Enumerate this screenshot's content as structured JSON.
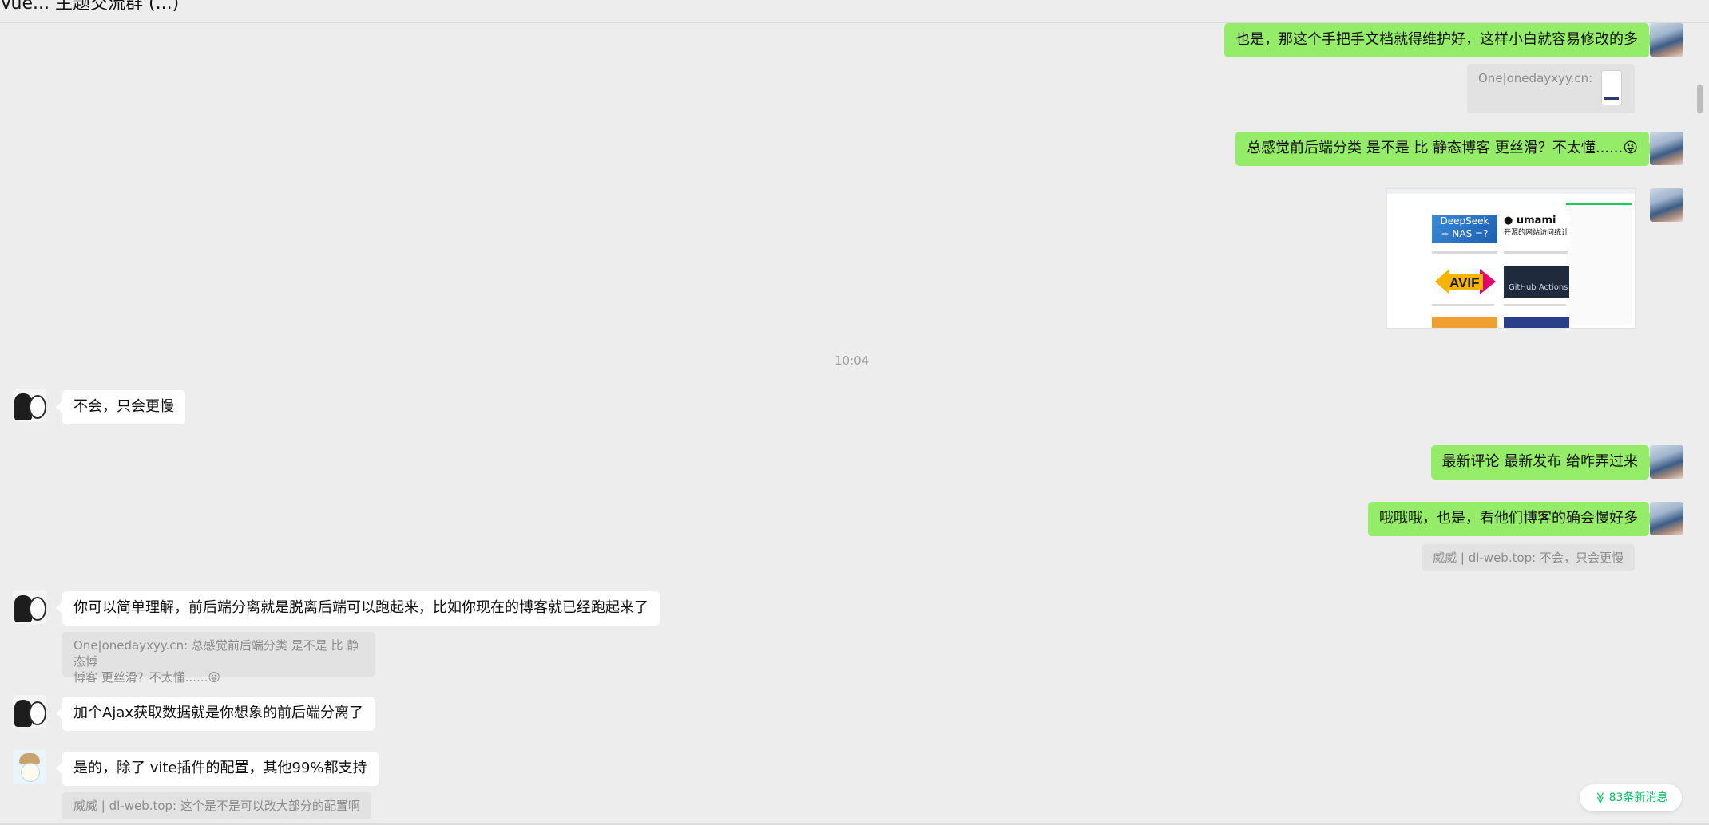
{
  "header": {
    "title": "Vue... 主题交流群 (...)",
    "more_icon": "⋯"
  },
  "messages": {
    "m1": "也是，那这个手把手文档就得维护好，这样小白就容易修改的多",
    "q1": "One|onedayxyy.cn:",
    "m2": "总感觉前后端分类 是不是 比 静态博客 更丝滑？不太懂......",
    "m2_emoji": "😜",
    "time": "10:04",
    "m3": "不会，只会更慢",
    "m4": "最新评论 最新发布 给咋弄过来",
    "m5": "哦哦哦，也是，看他们博客的确会慢好多",
    "q5": "威威 | dl-web.top: 不会，只会更慢",
    "m6": "你可以简单理解，前后端分离就是脱离后端可以跑起来，比如你现在的博客就已经跑起来了",
    "q6_line1": "One|onedayxyy.cn: 总感觉前后端分类 是不是 比 静态博",
    "q6_line2": "博客 更丝滑？不太懂......",
    "m7": "加个Ajax获取数据就是你想象的前后端分离了",
    "m8": "是的，除了 vite插件的配置，其他99%都支持",
    "q8": "威威 | dl-web.top: 这个是不是可以改大部分的配置啊"
  },
  "shot": {
    "deep_line1": "DeepSeek",
    "deep_line2": "+ NAS =?",
    "avif": "AVIF",
    "umami": "umami",
    "umami_sub": "开源的网站访问统计",
    "github": "GitHub Actions"
  },
  "new_messages": {
    "label": "83条新消息",
    "icon": "≫"
  },
  "colors": {
    "green_bubble": "#95ec69",
    "accent": "#07c160",
    "background": "#ededed"
  }
}
